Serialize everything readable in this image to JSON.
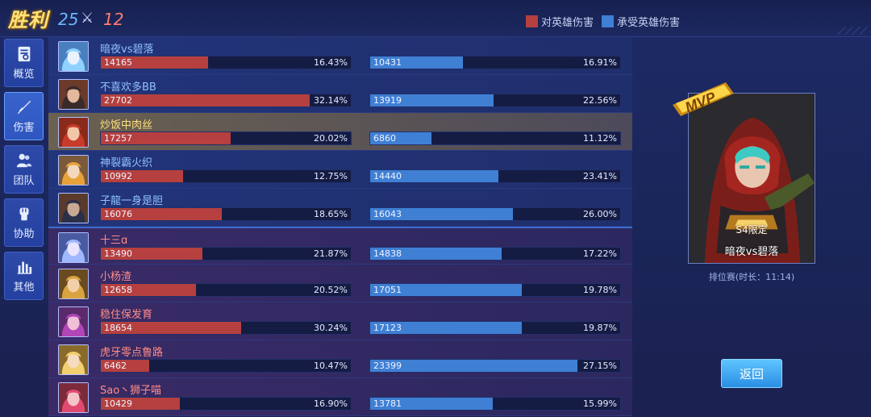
{
  "header": {
    "result": "胜利",
    "kills_own": "25",
    "kills_enemy": "12",
    "legend_dealt": "对英雄伤害",
    "legend_taken": "承受英雄伤害"
  },
  "colors": {
    "dealt": "#b5403f",
    "taken": "#3f7fd4",
    "ally_name": "#8fc0ff",
    "enemy_name": "#ff8c86",
    "self_name": "#ffe07a"
  },
  "sidebar": {
    "items": [
      {
        "label": "概览",
        "icon": "overview-icon",
        "active": false
      },
      {
        "label": "伤害",
        "icon": "sword-icon",
        "active": true
      },
      {
        "label": "团队",
        "icon": "team-icon",
        "active": false
      },
      {
        "label": "协助",
        "icon": "fist-icon",
        "active": false
      },
      {
        "label": "其他",
        "icon": "bar-chart-icon",
        "active": false
      }
    ]
  },
  "players": [
    {
      "name": "暗夜vs碧落",
      "team": "ally",
      "dealt": "14165",
      "dealt_pct": "16.43%",
      "dealt_fill": 0.428,
      "taken": "10431",
      "taken_pct": "16.91%",
      "taken_fill": 0.37
    },
    {
      "name": "不喜欢多BB",
      "team": "ally",
      "dealt": "27702",
      "dealt_pct": "32.14%",
      "dealt_fill": 0.835,
      "taken": "13919",
      "taken_pct": "22.56%",
      "taken_fill": 0.494
    },
    {
      "name": "炒饭中肉丝",
      "team": "self",
      "dealt": "17257",
      "dealt_pct": "20.02%",
      "dealt_fill": 0.518,
      "taken": "6860",
      "taken_pct": "11.12%",
      "taken_fill": 0.245
    },
    {
      "name": "神裂霸火织",
      "team": "ally",
      "dealt": "10992",
      "dealt_pct": "12.75%",
      "dealt_fill": 0.33,
      "taken": "14440",
      "taken_pct": "23.41%",
      "taken_fill": 0.513
    },
    {
      "name": "子龍一身是胆",
      "team": "ally",
      "dealt": "16076",
      "dealt_pct": "18.65%",
      "dealt_fill": 0.485,
      "taken": "16043",
      "taken_pct": "26.00%",
      "taken_fill": 0.57
    },
    {
      "name": "十三ɑ",
      "team": "enemy",
      "dealt": "13490",
      "dealt_pct": "21.87%",
      "dealt_fill": 0.406,
      "taken": "14838",
      "taken_pct": "17.22%",
      "taken_fill": 0.527
    },
    {
      "name": "小杨渣",
      "team": "enemy",
      "dealt": "12658",
      "dealt_pct": "20.52%",
      "dealt_fill": 0.38,
      "taken": "17051",
      "taken_pct": "19.78%",
      "taken_fill": 0.606
    },
    {
      "name": "稳住保发育",
      "team": "enemy",
      "dealt": "18654",
      "dealt_pct": "30.24%",
      "dealt_fill": 0.56,
      "taken": "17123",
      "taken_pct": "19.87%",
      "taken_fill": 0.608
    },
    {
      "name": "虎牙零点鲁路",
      "team": "enemy",
      "dealt": "6462",
      "dealt_pct": "10.47%",
      "dealt_fill": 0.195,
      "taken": "23399",
      "taken_pct": "27.15%",
      "taken_fill": 0.83
    },
    {
      "name": "Sao丶狮子喵",
      "team": "enemy",
      "dealt": "10429",
      "dealt_pct": "16.90%",
      "dealt_fill": 0.315,
      "taken": "13781",
      "taken_pct": "15.99%",
      "taken_fill": 0.49
    }
  ],
  "mvp": {
    "badge": "MVP",
    "tag": "S4限定",
    "name": "暗夜vs碧落",
    "match_info": "排位赛(时长：11:14)"
  },
  "back_label": "返回"
}
